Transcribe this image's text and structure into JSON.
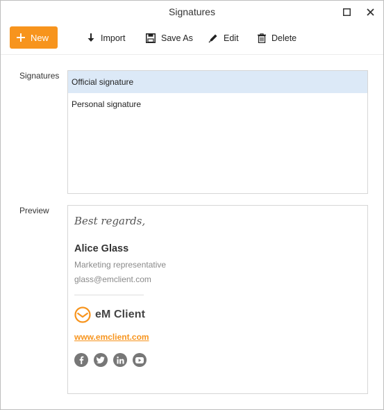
{
  "window": {
    "title": "Signatures"
  },
  "toolbar": {
    "new_label": "New",
    "import_label": "Import",
    "saveas_label": "Save As",
    "edit_label": "Edit",
    "delete_label": "Delete"
  },
  "labels": {
    "signatures": "Signatures",
    "preview": "Preview"
  },
  "signatures": [
    {
      "name": "Official signature",
      "selected": true
    },
    {
      "name": "Personal signature",
      "selected": false
    }
  ],
  "preview": {
    "greeting": "Best regards,",
    "name": "Alice Glass",
    "role": "Marketing representative",
    "email": "glass@emclient.com",
    "logo_text": "eM Client",
    "website": "www.emclient.com",
    "social_icons": [
      "facebook-icon",
      "twitter-icon",
      "linkedin-icon",
      "youtube-icon"
    ]
  },
  "colors": {
    "accent": "#f7941d",
    "selection": "#dce9f7"
  }
}
